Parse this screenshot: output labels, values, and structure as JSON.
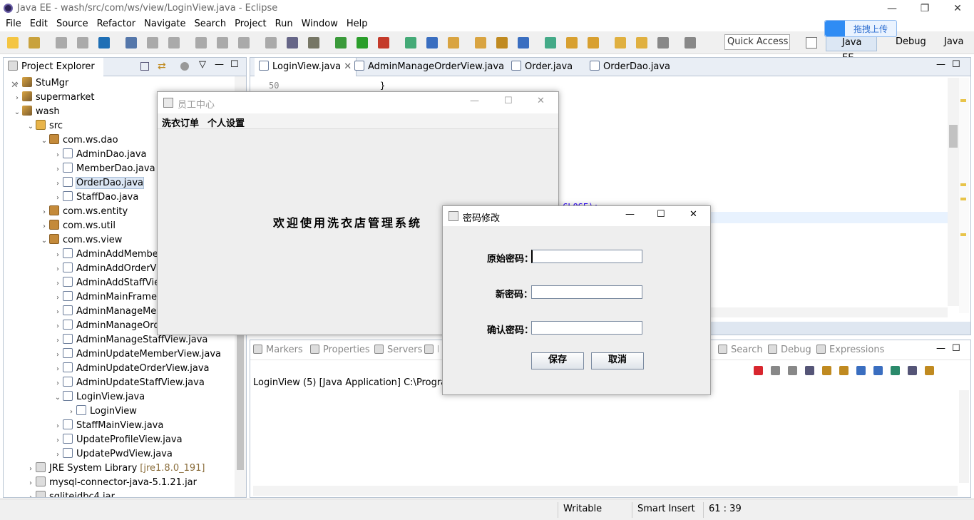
{
  "window": {
    "title": "Java EE - wash/src/com/ws/view/LoginView.java - Eclipse"
  },
  "menu": [
    "File",
    "Edit",
    "Source",
    "Refactor",
    "Navigate",
    "Search",
    "Project",
    "Run",
    "Window",
    "Help"
  ],
  "quick_access": {
    "placeholder": "Quick Access"
  },
  "perspectives": [
    "Java EE",
    "Debug",
    "Java"
  ],
  "upload_badge": "拖拽上传",
  "project_explorer": {
    "title": "Project Explorer",
    "rows": [
      {
        "label": "StuMgr",
        "indent": 0,
        "arrow": "›",
        "icon": "project"
      },
      {
        "label": "supermarket",
        "indent": 0,
        "arrow": "›",
        "icon": "project"
      },
      {
        "label": "wash",
        "indent": 0,
        "arrow": "⌄",
        "icon": "project"
      },
      {
        "label": "src",
        "indent": 1,
        "arrow": "⌄",
        "icon": "src"
      },
      {
        "label": "com.ws.dao",
        "indent": 2,
        "arrow": "⌄",
        "icon": "package"
      },
      {
        "label": "AdminDao.java",
        "indent": 3,
        "arrow": "›",
        "icon": "java"
      },
      {
        "label": "MemberDao.java",
        "indent": 3,
        "arrow": "›",
        "icon": "java"
      },
      {
        "label": "OrderDao.java",
        "indent": 3,
        "arrow": "›",
        "icon": "java",
        "selected": true
      },
      {
        "label": "StaffDao.java",
        "indent": 3,
        "arrow": "›",
        "icon": "java"
      },
      {
        "label": "com.ws.entity",
        "indent": 2,
        "arrow": "›",
        "icon": "package"
      },
      {
        "label": "com.ws.util",
        "indent": 2,
        "arrow": "›",
        "icon": "package"
      },
      {
        "label": "com.ws.view",
        "indent": 2,
        "arrow": "⌄",
        "icon": "package"
      },
      {
        "label": "AdminAddMemberView.java",
        "indent": 3,
        "arrow": "›",
        "icon": "java"
      },
      {
        "label": "AdminAddOrderView.java",
        "indent": 3,
        "arrow": "›",
        "icon": "java"
      },
      {
        "label": "AdminAddStaffView.java",
        "indent": 3,
        "arrow": "›",
        "icon": "java"
      },
      {
        "label": "AdminMainFrame.java",
        "indent": 3,
        "arrow": "›",
        "icon": "java"
      },
      {
        "label": "AdminManageMemberView.java",
        "indent": 3,
        "arrow": "›",
        "icon": "java"
      },
      {
        "label": "AdminManageOrderView.java",
        "indent": 3,
        "arrow": "›",
        "icon": "java"
      },
      {
        "label": "AdminManageStaffView.java",
        "indent": 3,
        "arrow": "›",
        "icon": "java"
      },
      {
        "label": "AdminUpdateMemberView.java",
        "indent": 3,
        "arrow": "›",
        "icon": "java"
      },
      {
        "label": "AdminUpdateOrderView.java",
        "indent": 3,
        "arrow": "›",
        "icon": "java"
      },
      {
        "label": "AdminUpdateStaffView.java",
        "indent": 3,
        "arrow": "›",
        "icon": "java"
      },
      {
        "label": "LoginView.java",
        "indent": 3,
        "arrow": "⌄",
        "icon": "java"
      },
      {
        "label": "LoginView",
        "indent": 4,
        "arrow": "›",
        "icon": "class"
      },
      {
        "label": "StaffMainView.java",
        "indent": 3,
        "arrow": "›",
        "icon": "java"
      },
      {
        "label": "UpdateProfileView.java",
        "indent": 3,
        "arrow": "›",
        "icon": "java"
      },
      {
        "label": "UpdatePwdView.java",
        "indent": 3,
        "arrow": "›",
        "icon": "java"
      },
      {
        "label": "JRE System Library",
        "extra": "[jre1.8.0_191]",
        "indent": 1,
        "arrow": "›",
        "icon": "lib"
      },
      {
        "label": "mysql-connector-java-5.1.21.jar",
        "indent": 1,
        "arrow": "›",
        "icon": "jar"
      },
      {
        "label": "sqlitejdbc4.jar",
        "indent": 1,
        "arrow": "›",
        "icon": "jar"
      }
    ]
  },
  "editor_tabs": [
    "LoginView.java",
    "AdminManageOrderView.java",
    "Order.java",
    "OrderDao.java"
  ],
  "editor": {
    "line_number": "50",
    "code": "}",
    "fragment": "CLOSE);"
  },
  "bottom_tabs": [
    "Markers",
    "Properties",
    "Servers",
    "Data Source Explorer",
    "Search",
    "Debug",
    "Expressions"
  ],
  "console": {
    "label": "LoginView (5) [Java Application] C:\\Program Files\\Java\\jre1.8.0_191\\bin\\javaw.exe"
  },
  "status": {
    "writable": "Writable",
    "insert": "Smart Insert",
    "position": "61 : 39"
  },
  "staff_window": {
    "title": "员工中心",
    "menu": [
      "洗衣订单",
      "个人设置"
    ],
    "welcome": "欢迎使用洗衣店管理系统"
  },
  "pwd_dialog": {
    "title": "密码修改",
    "old_label": "原始密码：",
    "new_label": "新密码：",
    "confirm_label": "确认密码：",
    "save": "保存",
    "cancel": "取消"
  }
}
